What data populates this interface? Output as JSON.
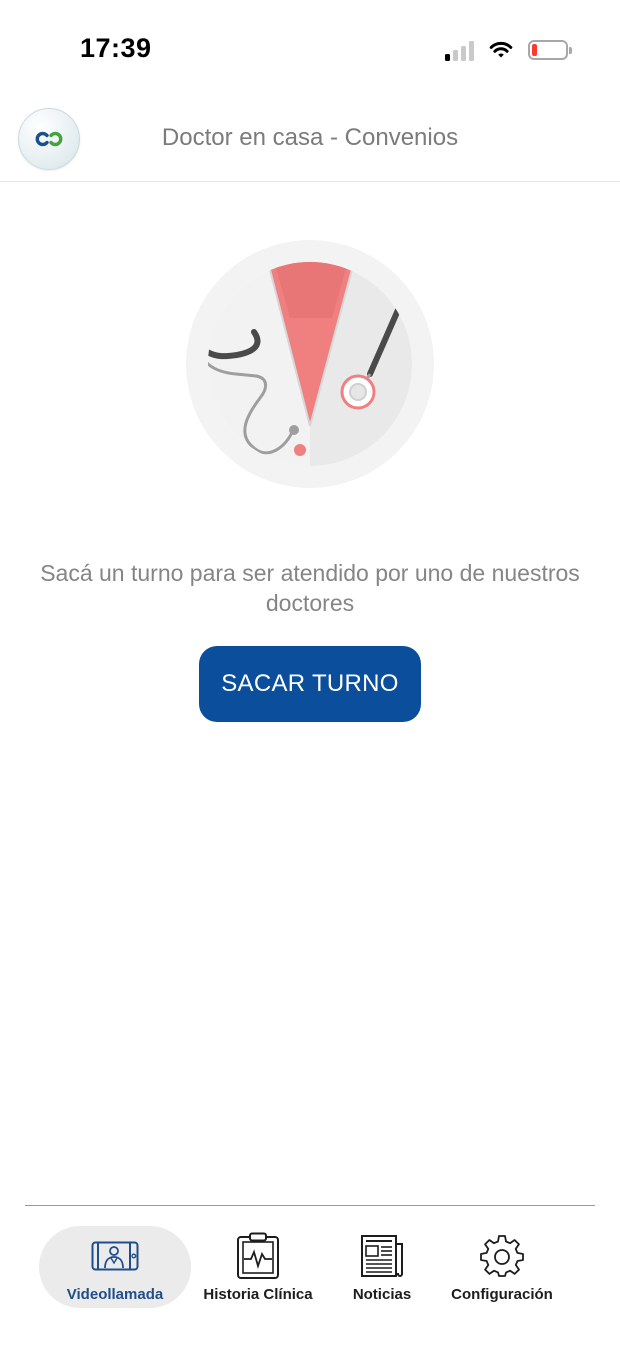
{
  "status_bar": {
    "time": "17:39",
    "icons": [
      "signal-icon",
      "wifi-icon",
      "battery-icon"
    ]
  },
  "header": {
    "title": "Doctor en casa - Convenios",
    "logo_icon": "app-logo-icon"
  },
  "main": {
    "illustration_icon": "doctor-illustration",
    "prompt": "Sacá un turno para ser atendido por uno de nuestros doctores",
    "button_label": "SACAR TURNO"
  },
  "bottom_nav": {
    "items": [
      {
        "label": "Videollamada",
        "icon": "video-call-icon",
        "active": true
      },
      {
        "label": "Historia Clínica",
        "icon": "clipboard-icon",
        "active": false
      },
      {
        "label": "Noticias",
        "icon": "newspaper-icon",
        "active": false
      },
      {
        "label": "Configuración",
        "icon": "gear-icon",
        "active": false
      }
    ]
  },
  "colors": {
    "primary": "#0b4f9c",
    "active_nav_text": "#1f4e8a",
    "title_text": "#7b7b7b",
    "battery_low": "#ff3b30"
  }
}
